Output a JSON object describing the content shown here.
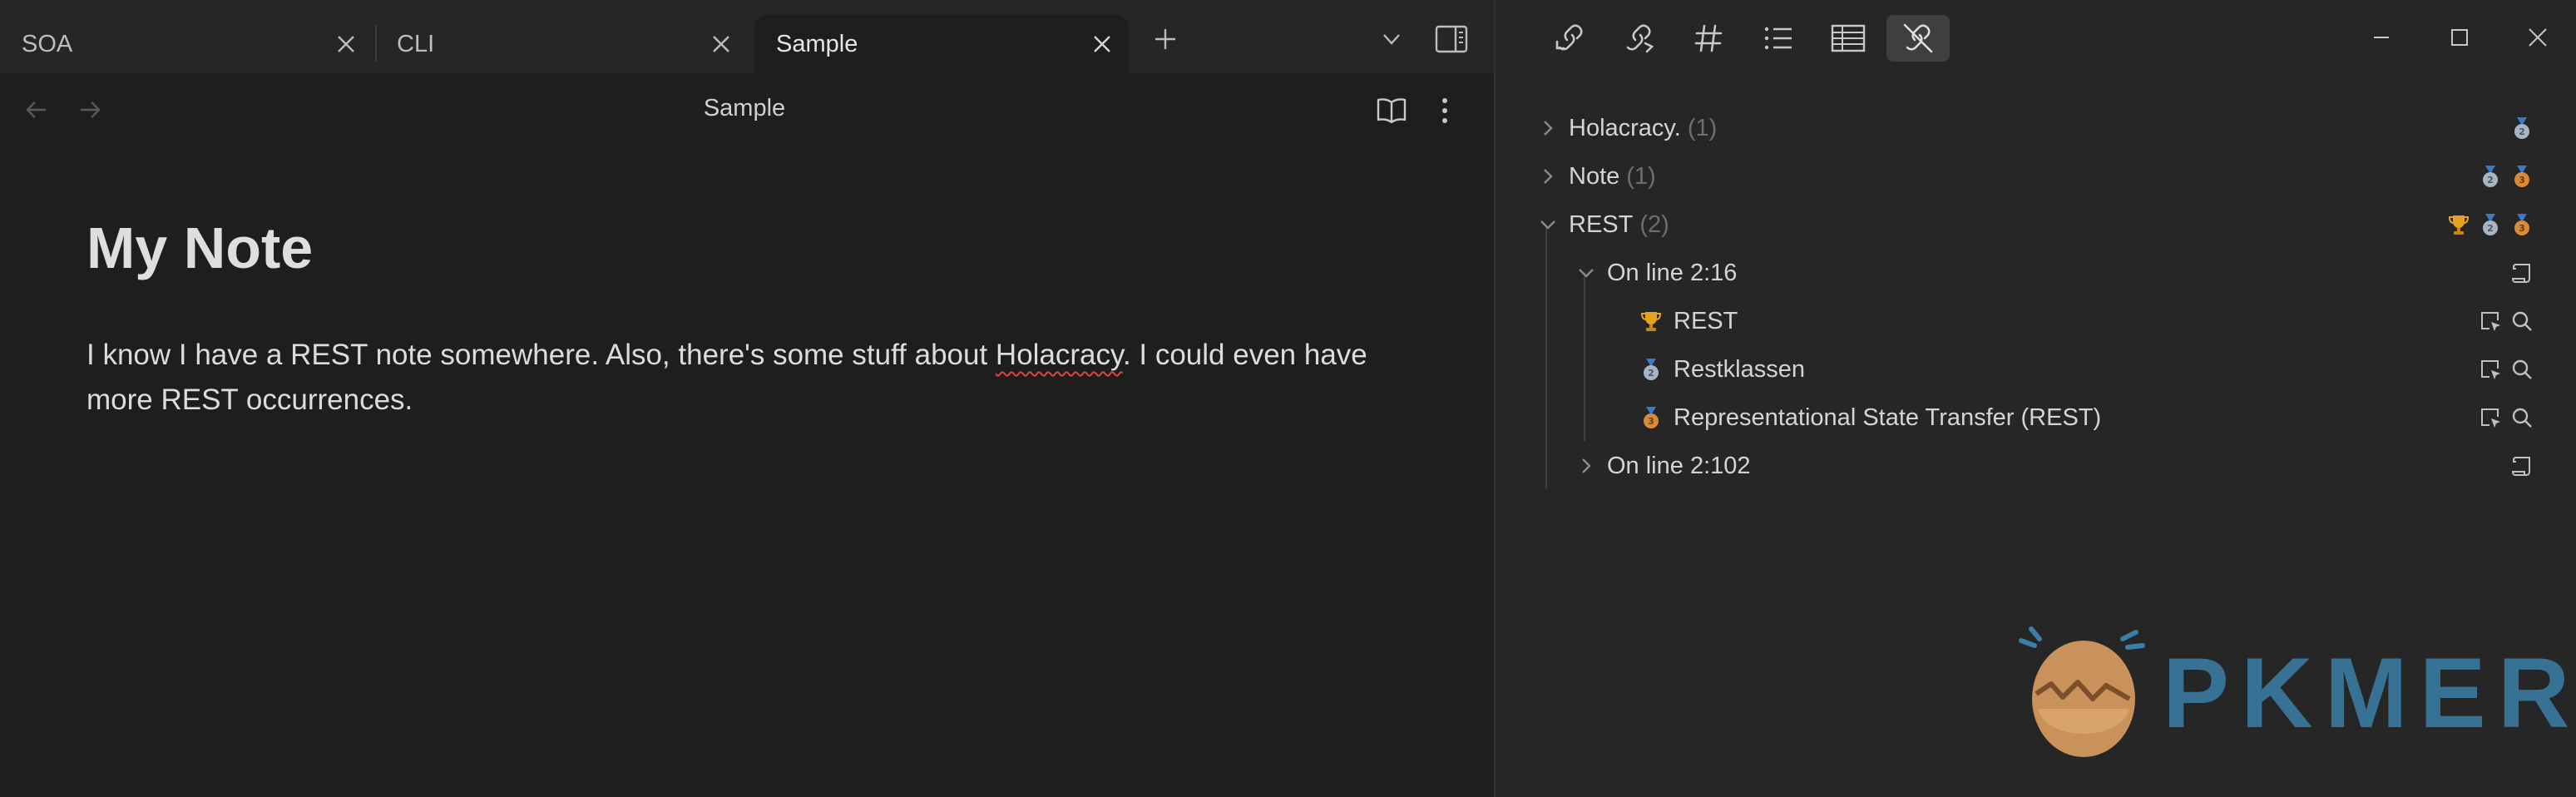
{
  "tabs": [
    {
      "label": "SOA"
    },
    {
      "label": "CLI"
    },
    {
      "label": "Sample",
      "active": true
    }
  ],
  "editor": {
    "view_title": "Sample",
    "heading": "My Note",
    "body_before": "I know I have a REST note somewhere. Also, there's some stuff about ",
    "body_misspelled": "Holacracy",
    "body_after": ". I could even have more REST occurrences."
  },
  "sidebar": {
    "toolbar_icons": [
      "backlink-icon",
      "outgoing-link-icon",
      "tag-icon",
      "list-icon",
      "table-icon",
      "crossed-link-icon"
    ],
    "tree": {
      "groups": [
        {
          "label": "Holacracy.",
          "count": "(1)",
          "medals": [
            "silver"
          ]
        },
        {
          "label": "Note",
          "count": "(1)",
          "medals": [
            "silver",
            "bronze"
          ]
        },
        {
          "label": "REST",
          "count": "(2)",
          "medals": [
            "gold",
            "silver",
            "bronze"
          ],
          "children": [
            {
              "label": "On line 2:16",
              "matches": [
                {
                  "label": "REST",
                  "medal": "gold"
                },
                {
                  "label": "Restklassen",
                  "medal": "silver"
                },
                {
                  "label": "Representational State Transfer (REST)",
                  "medal": "bronze"
                }
              ]
            },
            {
              "label": "On line 2:102"
            }
          ]
        }
      ]
    }
  },
  "watermark": {
    "text": "PKMER"
  },
  "colors": {
    "gold": "#e7a31e",
    "silver": "#a7b4c2",
    "bronze": "#d98b3a",
    "ribbon": "#3d78c9",
    "misspell": "#e0443e",
    "watermark": "#3b7fa6"
  }
}
